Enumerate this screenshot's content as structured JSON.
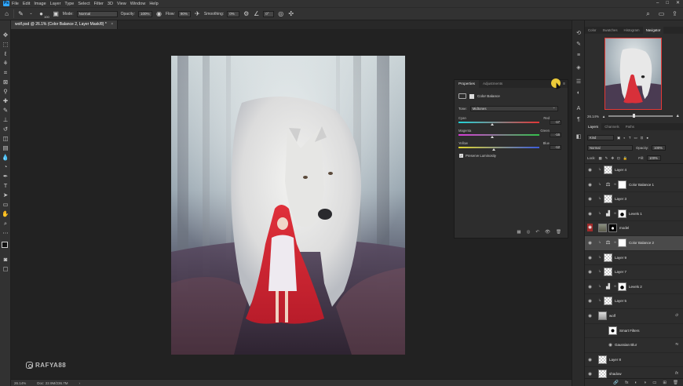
{
  "menubar": {
    "logo": "Ps",
    "items": [
      "File",
      "Edit",
      "Image",
      "Layer",
      "Type",
      "Select",
      "Filter",
      "3D",
      "View",
      "Window",
      "Help"
    ],
    "window_controls": [
      "–",
      "□",
      "✕"
    ]
  },
  "options": {
    "brush_size": "100",
    "mode_label": "Mode:",
    "mode_value": "Normal",
    "opacity_label": "Opacity:",
    "opacity_value": "100%",
    "flow_label": "Flow:",
    "flow_value": "90%",
    "smoothing_label": "Smoothing:",
    "smoothing_value": "0%",
    "angle_value": "0°"
  },
  "document": {
    "tab_title": "wolf.psd @ 26.1% (Color Balance 2, Layer Mask/8) *",
    "close": "×"
  },
  "status": {
    "zoom": "26.14%",
    "doc_info": "Doc: 22.9M/236.7M",
    "arrow": "›"
  },
  "watermark": {
    "handle": "RAFYA88"
  },
  "properties": {
    "tabs": [
      "Properties",
      "Adjustments"
    ],
    "menu": "≡",
    "adjustment_name": "Color Balance",
    "tone_label": "Tone:",
    "tone_value": "Midtones",
    "sliders": [
      {
        "left": "Cyan",
        "right": "Red",
        "value": "-17",
        "level": -17
      },
      {
        "left": "Magenta",
        "right": "Green",
        "value": "-16",
        "level": -16
      },
      {
        "left": "Yellow",
        "right": "Blue",
        "value": "-12",
        "level": -12
      }
    ],
    "preserve_label": "Preserve Luminosity",
    "preserve_checked": "✓",
    "bottom_icons": [
      "▦",
      "◎",
      "↶",
      "👁",
      "🗑"
    ]
  },
  "navigator": {
    "tabs": [
      "Color",
      "Swatches",
      "Histogram",
      "Navigator"
    ],
    "active_tab": 3,
    "zoom": "26.14%"
  },
  "layers_panel": {
    "tabs": [
      "Layers",
      "Channels",
      "Paths"
    ],
    "kind_label": "Kind",
    "blend_mode": "Normal",
    "opacity_label": "Opacity:",
    "opacity_value": "100%",
    "lock_label": "Lock:",
    "fill_label": "Fill:",
    "fill_value": "100%",
    "layers": [
      {
        "name": "Layer 4",
        "kind": "pixel",
        "clipped": true
      },
      {
        "name": "Color Balance 1",
        "kind": "adjust",
        "clipped": true
      },
      {
        "name": "Layer 3",
        "kind": "pixel",
        "clipped": true
      },
      {
        "name": "Levels 1",
        "kind": "levels",
        "clipped": true
      },
      {
        "name": "model",
        "kind": "photo",
        "clipped": false,
        "red_eye": true
      },
      {
        "name": "Color Balance 2",
        "kind": "adjust",
        "clipped": true,
        "selected": true
      },
      {
        "name": "Layer 9",
        "kind": "pixel",
        "clipped": true
      },
      {
        "name": "Layer 7",
        "kind": "pixel",
        "clipped": true
      },
      {
        "name": "Levels 2",
        "kind": "levels",
        "clipped": true
      },
      {
        "name": "Layer 5",
        "kind": "pixel",
        "clipped": true
      },
      {
        "name": "wolf",
        "kind": "smart",
        "clipped": false
      },
      {
        "name": "Smart Filters",
        "kind": "filtermask",
        "clipped": false
      },
      {
        "name": "Gaussian Blur",
        "kind": "filter",
        "clipped": false
      },
      {
        "name": "Layer 8",
        "kind": "pixel",
        "clipped": false
      },
      {
        "name": "shadow",
        "kind": "pixel",
        "clipped": false
      }
    ],
    "fx": "fx",
    "footer_icons": [
      "🔗",
      "fx",
      "◐",
      "◑",
      "▭",
      "⊞",
      "🗑"
    ]
  }
}
